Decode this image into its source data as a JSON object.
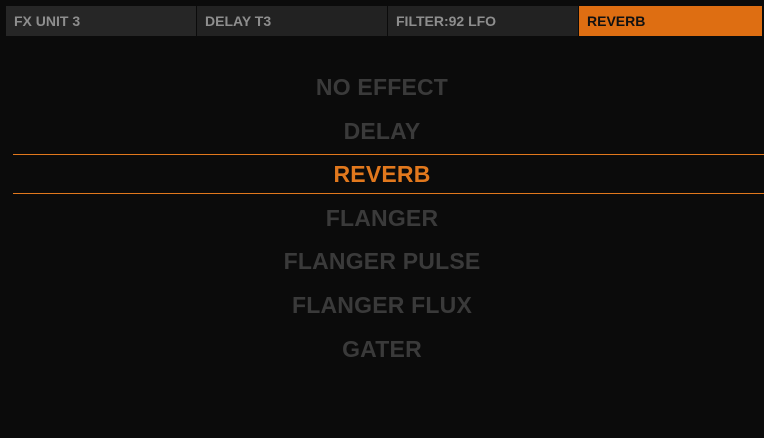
{
  "colors": {
    "background": "#0b0b0b",
    "accent": "#e1781d",
    "tab_active_bg": "#de6e12",
    "inactive_text": "#3a3a3a",
    "tab_text": "#8e8e8e"
  },
  "header": {
    "tabs": [
      {
        "label": "FX UNIT 3",
        "active": false
      },
      {
        "label": "DELAY T3",
        "active": false
      },
      {
        "label": "FILTER:92 LFO",
        "active": false
      },
      {
        "label": "REVERB",
        "active": true
      }
    ]
  },
  "effect_list": {
    "selected_index": 2,
    "items": [
      {
        "label": "NO EFFECT"
      },
      {
        "label": "DELAY"
      },
      {
        "label": "REVERB"
      },
      {
        "label": "FLANGER"
      },
      {
        "label": "FLANGER PULSE"
      },
      {
        "label": "FLANGER FLUX"
      },
      {
        "label": "GATER"
      }
    ]
  }
}
